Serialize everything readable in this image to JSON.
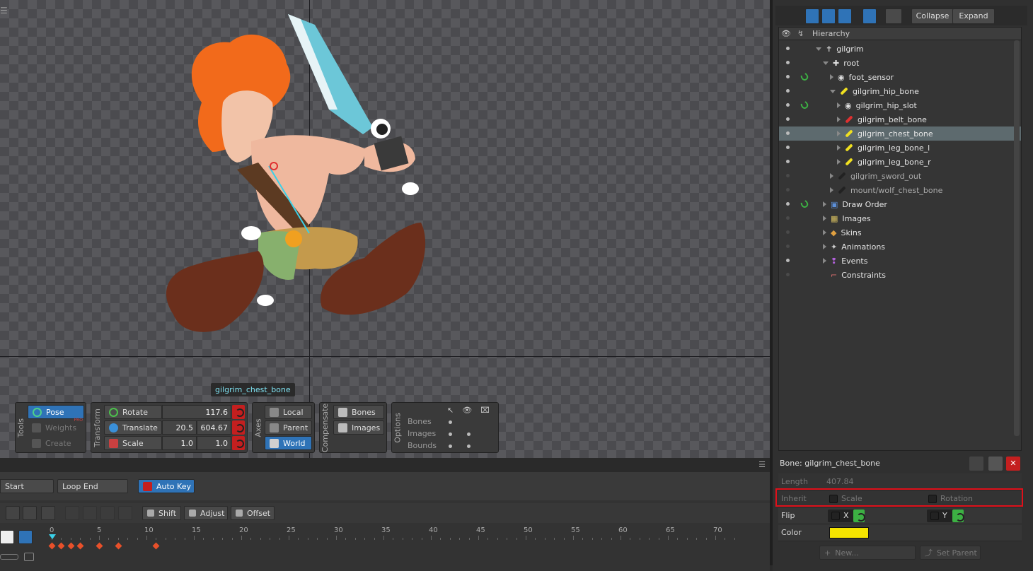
{
  "viewport": {
    "selected_bone_tag": "gilgrim_chest_bone"
  },
  "tools_panel": {
    "title": "Tools",
    "pose": "Pose",
    "weights": "Weights",
    "weights_badge": "PRO",
    "create": "Create"
  },
  "transform_panel": {
    "title": "Transform",
    "rotate_label": "Rotate",
    "rotate_value": "117.6",
    "translate_label": "Translate",
    "translate_x": "20.5",
    "translate_y": "604.67",
    "scale_label": "Scale",
    "scale_x": "1.0",
    "scale_y": "1.0"
  },
  "axes_panel": {
    "title": "Axes",
    "local": "Local",
    "parent": "Parent",
    "world": "World"
  },
  "compensate_panel": {
    "title": "Compensate",
    "bones": "Bones",
    "images": "Images"
  },
  "options_panel": {
    "title": "Options",
    "rows": [
      "Bones",
      "Images",
      "Bounds"
    ]
  },
  "toolbar": {
    "collapse": "Collapse",
    "expand": "Expand"
  },
  "tree": {
    "header": "Hierarchy",
    "items": [
      {
        "label": "gilgrim",
        "depth": 0,
        "eye": true,
        "link": false,
        "icon": "skeleton-icon",
        "arrow": "down"
      },
      {
        "label": "root",
        "depth": 1,
        "eye": true,
        "link": false,
        "icon": "root-icon",
        "arrow": "down"
      },
      {
        "label": "foot_sensor",
        "depth": 2,
        "eye": true,
        "link": true,
        "icon": "slot-icon",
        "arrow": "right"
      },
      {
        "label": "gilgrim_hip_bone",
        "depth": 2,
        "eye": true,
        "link": false,
        "icon": "bone-icon",
        "arrow": "down",
        "color": "#f0e020"
      },
      {
        "label": "gilgrim_hip_slot",
        "depth": 3,
        "eye": true,
        "link": true,
        "icon": "slot-icon",
        "arrow": "right"
      },
      {
        "label": "gilgrim_belt_bone",
        "depth": 3,
        "eye": true,
        "link": false,
        "icon": "bone-icon",
        "arrow": "right",
        "color": "#e03030"
      },
      {
        "label": "gilgrim_chest_bone",
        "depth": 3,
        "eye": true,
        "link": false,
        "icon": "bone-icon",
        "arrow": "right",
        "color": "#f0e020",
        "selected": true
      },
      {
        "label": "gilgrim_leg_bone_l",
        "depth": 3,
        "eye": true,
        "link": false,
        "icon": "bone-icon",
        "arrow": "right",
        "color": "#f0e020"
      },
      {
        "label": "gilgrim_leg_bone_r",
        "depth": 3,
        "eye": true,
        "link": false,
        "icon": "bone-icon",
        "arrow": "right",
        "color": "#f0e020"
      },
      {
        "label": "gilgrim_sword_out",
        "depth": 2,
        "eye": false,
        "link": false,
        "icon": "bone-icon",
        "arrow": "right",
        "color": "#222222",
        "dim": true
      },
      {
        "label": "mount/wolf_chest_bone",
        "depth": 2,
        "eye": false,
        "link": false,
        "icon": "bone-icon",
        "arrow": "right",
        "color": "#222222",
        "dim": true
      },
      {
        "label": "Draw Order",
        "depth": 1,
        "eye": true,
        "link": true,
        "icon": "draw-order-icon",
        "arrow": "right"
      },
      {
        "label": "Images",
        "depth": 1,
        "eye": false,
        "link": false,
        "icon": "images-icon",
        "arrow": "right"
      },
      {
        "label": "Skins",
        "depth": 1,
        "eye": false,
        "link": false,
        "icon": "skins-icon",
        "arrow": "right"
      },
      {
        "label": "Animations",
        "depth": 1,
        "eye": false,
        "link": false,
        "icon": "animations-icon",
        "arrow": "right"
      },
      {
        "label": "Events",
        "depth": 1,
        "eye": true,
        "link": false,
        "icon": "events-icon",
        "arrow": "right"
      },
      {
        "label": "Constraints",
        "depth": 1,
        "eye": false,
        "link": false,
        "icon": "constraints-icon",
        "arrow": "none"
      }
    ]
  },
  "properties": {
    "title": "Bone: gilgrim_chest_bone",
    "length_label": "Length",
    "length_value": "407.84",
    "inherit_label": "Inherit",
    "inherit_scale": "Scale",
    "inherit_rotation": "Rotation",
    "flip_label": "Flip",
    "flip_x": "X",
    "flip_y": "Y",
    "color_label": "Color",
    "color_value": "#f5e400",
    "new_button": "New...",
    "set_parent_button": "Set Parent"
  },
  "timeline": {
    "loop_start": "Start",
    "loop_end": "Loop End",
    "auto_key": "Auto Key",
    "shift": "Shift",
    "adjust": "Adjust",
    "offset": "Offset",
    "ticks": [
      "0",
      "5",
      "10",
      "15",
      "20",
      "25",
      "30",
      "35",
      "40",
      "45",
      "50",
      "55",
      "60",
      "65",
      "70"
    ],
    "keyframes": [
      0,
      1,
      2,
      3,
      5,
      7,
      11
    ]
  }
}
